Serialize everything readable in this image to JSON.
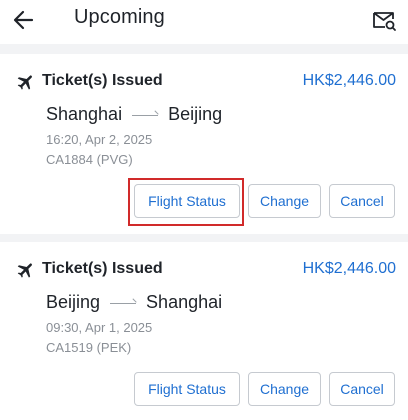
{
  "header": {
    "title": "Upcoming",
    "back_icon": "arrow-left-icon",
    "mail_icon": "mail-search-icon"
  },
  "colors": {
    "accent": "#1f6fd1",
    "highlight": "#d12a2a"
  },
  "bookings": [
    {
      "status": "Ticket(s) Issued",
      "price": "HK$2,446.00",
      "origin": "Shanghai",
      "destination": "Beijing",
      "datetime": "16:20, Apr 2, 2025",
      "flight": "CA1884 (PVG)",
      "buttons": {
        "status": "Flight Status",
        "change": "Change",
        "cancel": "Cancel"
      }
    },
    {
      "status": "Ticket(s) Issued",
      "price": "HK$2,446.00",
      "origin": "Beijing",
      "destination": "Shanghai",
      "datetime": "09:30, Apr 1, 2025",
      "flight": "CA1519 (PEK)",
      "buttons": {
        "status": "Flight Status",
        "change": "Change",
        "cancel": "Cancel"
      }
    }
  ]
}
